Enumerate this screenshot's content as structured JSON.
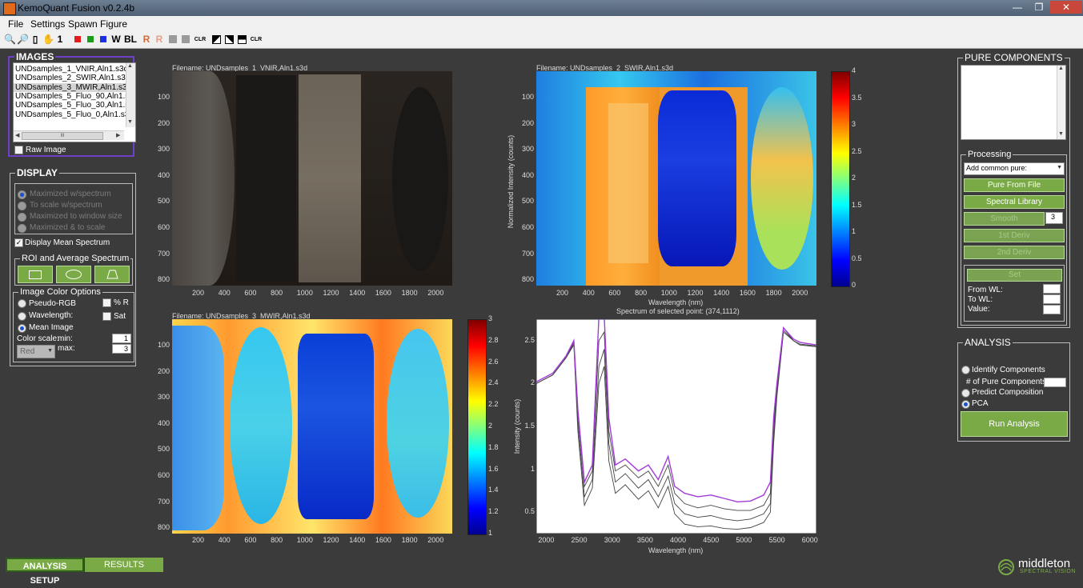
{
  "window": {
    "title": "KemoQuant Fusion v0.2.4b",
    "min_glyph": "—",
    "max_glyph": "❐",
    "close_glyph": "✕"
  },
  "menu": [
    "File",
    "Settings",
    "Spawn Figure"
  ],
  "toolbar": {
    "one": "1",
    "w": "W",
    "bl": "BL",
    "r1": "R",
    "r2": "R",
    "clr1": "CLR",
    "clr2": "CLR",
    "colors": {
      "red": "#e31b1b",
      "green": "#1a9c1a",
      "blue": "#1d2fe0"
    }
  },
  "images_panel": {
    "title": "IMAGES",
    "files": [
      "UNDsamples_1_VNIR,Aln1.s3d",
      "UNDsamples_2_SWIR,Aln1.s3d",
      "UNDsamples_3_MWIR,Aln1.s3d",
      "UNDsamples_5_Fluo_90,Aln1.s3",
      "UNDsamples_5_Fluo_30,Aln1.s3",
      "UNDsamples_5_Fluo_0,Aln1.s3"
    ],
    "selected_index": 2,
    "scroll_glyph": "III",
    "raw_image_label": "Raw Image"
  },
  "display_panel": {
    "title": "DISPLAY",
    "size_options": [
      "Maximized w/spectrum",
      "To scale w/spectrum",
      "Maximized to window size",
      "Maximized & to scale"
    ],
    "display_mean_spectrum": "Display Mean Spectrum",
    "roi_title": "ROI and Average Spectrum",
    "color_options_title": "Image Color Options",
    "pseudo_rgb": "Pseudo-RGB",
    "wavelength": "Wavelength:",
    "mean_image": "Mean Image",
    "pct_r": "% R",
    "sat": "Sat",
    "color_scale": "Color scale:",
    "min_label": "min:",
    "max_label": "max:",
    "min_value": "1",
    "max_value": "3",
    "color_select": "Red"
  },
  "pure_components": {
    "title": "PURE COMPONENTS",
    "processing_title": "Processing",
    "add_common": "Add common pure:",
    "pure_from_file": "Pure From File",
    "spectral_library": "Spectral Library",
    "smooth": "Smooth",
    "smooth_value": "3",
    "first_deriv": "1st Deriv",
    "second_deriv": "2nd Deriv",
    "set": "Set",
    "from_wl": "From WL:",
    "to_wl": "To WL:",
    "value": "Value:"
  },
  "analysis": {
    "title": "ANALYSIS",
    "identify": "Identify Components",
    "num_pure": "# of Pure Components:",
    "predict": "Predict Composition",
    "pca": "PCA",
    "run": "Run Analysis"
  },
  "plots": {
    "vnir_filename": "Filename: UNDsamples_1_VNIR,Aln1.s3d",
    "swir_filename": "Filename: UNDsamples_2_SWIR,Aln1.s3d",
    "mwir_filename": "Filename: UNDsamples_3_MWIR,Aln1.s3d",
    "image_xticks": [
      "200",
      "400",
      "600",
      "800",
      "1000",
      "1200",
      "1400",
      "1600",
      "1800",
      "2000"
    ],
    "image_yticks": [
      "100",
      "200",
      "300",
      "400",
      "500",
      "600",
      "700",
      "800"
    ],
    "swir_xlabel": "Wavelength (nm)",
    "swir_ylabel": "Normalized Intensity (counts)",
    "swir_cbar_ticks": [
      "4",
      "3.5",
      "3",
      "2.5",
      "2",
      "1.5",
      "1",
      "0.5",
      "0"
    ],
    "mwir_cbar_ticks": [
      "3",
      "2.8",
      "2.6",
      "2.4",
      "2.2",
      "2",
      "1.8",
      "1.6",
      "1.4",
      "1.2",
      "1"
    ]
  },
  "chart_data": {
    "type": "line",
    "title": "Spectrum of selected point: (374,1112)",
    "xlabel": "Wavelength (nm)",
    "ylabel": "Intensity (counts)",
    "xlim": [
      1850,
      6100
    ],
    "ylim": [
      0.25,
      2.75
    ],
    "xticks": [
      "2000",
      "2500",
      "3000",
      "3500",
      "4000",
      "4500",
      "5000",
      "5500",
      "6000"
    ],
    "yticks": [
      "2.5",
      "2",
      "1.5",
      "1",
      "0.5"
    ],
    "x": [
      1850,
      2100,
      2300,
      2420,
      2480,
      2580,
      2700,
      2800,
      2880,
      2950,
      3050,
      3200,
      3400,
      3550,
      3700,
      3850,
      3950,
      4100,
      4300,
      4500,
      4700,
      4900,
      5100,
      5300,
      5400,
      5450,
      5500,
      5600,
      5750,
      5850,
      6100
    ],
    "series": [
      {
        "color": "#a23bd9",
        "values": [
          2.02,
          2.12,
          2.32,
          2.5,
          1.7,
          0.85,
          1.05,
          2.78,
          2.8,
          1.6,
          1.05,
          1.12,
          0.98,
          1.05,
          0.88,
          1.15,
          0.8,
          0.72,
          0.68,
          0.7,
          0.66,
          0.62,
          0.63,
          0.7,
          0.85,
          1.6,
          2.0,
          2.65,
          2.52,
          2.48,
          2.45
        ]
      },
      {
        "color": "#444444",
        "values": [
          2.0,
          2.1,
          2.3,
          2.48,
          1.65,
          0.8,
          0.98,
          2.5,
          2.6,
          1.45,
          0.98,
          1.05,
          0.9,
          0.98,
          0.8,
          1.05,
          0.72,
          0.6,
          0.55,
          0.58,
          0.54,
          0.52,
          0.52,
          0.58,
          0.72,
          1.5,
          1.95,
          2.65,
          2.5,
          2.46,
          2.44
        ]
      },
      {
        "color": "#444444",
        "values": [
          2.0,
          2.1,
          2.3,
          2.46,
          1.55,
          0.68,
          0.88,
          2.2,
          2.4,
          1.3,
          0.85,
          0.95,
          0.78,
          0.88,
          0.68,
          0.92,
          0.6,
          0.48,
          0.44,
          0.46,
          0.42,
          0.4,
          0.42,
          0.48,
          0.6,
          1.4,
          1.9,
          2.62,
          2.5,
          2.45,
          2.43
        ]
      },
      {
        "color": "#444444",
        "values": [
          2.0,
          2.1,
          2.3,
          2.45,
          1.45,
          0.58,
          0.78,
          2.0,
          2.2,
          1.1,
          0.72,
          0.82,
          0.65,
          0.75,
          0.55,
          0.8,
          0.48,
          0.36,
          0.33,
          0.34,
          0.31,
          0.3,
          0.32,
          0.38,
          0.5,
          1.3,
          1.85,
          2.6,
          2.5,
          2.45,
          2.43
        ]
      }
    ]
  },
  "tabs": {
    "setup": "ANALYSIS SETUP",
    "results": "RESULTS"
  },
  "logo": {
    "name": "middleton",
    "sub": "SPECTRAL VISION"
  }
}
